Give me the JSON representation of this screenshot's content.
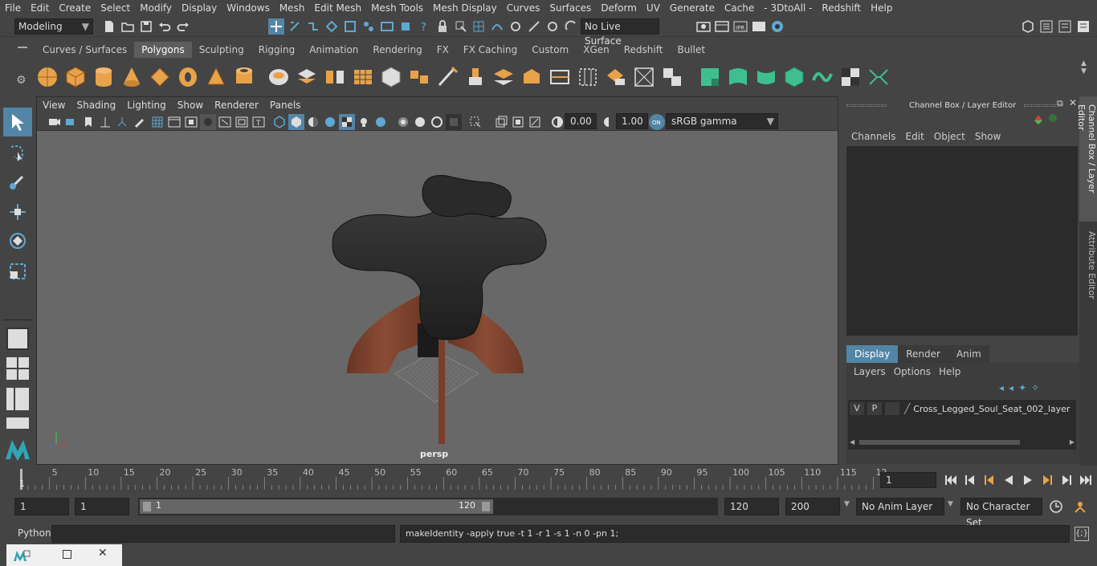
{
  "menubar": {
    "items": [
      "File",
      "Edit",
      "Create",
      "Select",
      "Modify",
      "Display",
      "Windows",
      "Mesh",
      "Edit Mesh",
      "Mesh Tools",
      "Mesh Display",
      "Curves",
      "Surfaces",
      "Deform",
      "UV",
      "Generate",
      "Cache",
      "- 3DtoAll -",
      "Redshift",
      "Help"
    ]
  },
  "statusline": {
    "mode": "Modeling",
    "live_surface": "No Live Surface"
  },
  "shelf": {
    "tabs": [
      "Curves / Surfaces",
      "Polygons",
      "Sculpting",
      "Rigging",
      "Animation",
      "Rendering",
      "FX",
      "FX Caching",
      "Custom",
      "XGen",
      "Redshift",
      "Bullet"
    ],
    "active_tab": "Polygons"
  },
  "viewport": {
    "menu": [
      "View",
      "Shading",
      "Lighting",
      "Show",
      "Renderer",
      "Panels"
    ],
    "exposure": "0.00",
    "gamma": "1.00",
    "colorspace": "sRGB gamma",
    "camera_label": "persp"
  },
  "channelbox": {
    "title": "Channel Box / Layer Editor",
    "menu": [
      "Channels",
      "Edit",
      "Object",
      "Show"
    ]
  },
  "layereditor": {
    "tabs": [
      "Display",
      "Render",
      "Anim"
    ],
    "active_tab": "Display",
    "menu": [
      "Layers",
      "Options",
      "Help"
    ],
    "layer": {
      "v": "V",
      "p": "P",
      "name": "Cross_Legged_Soul_Seat_002_layer"
    }
  },
  "sidetabs": {
    "channel": "Channel Box / Layer Editor",
    "attribute": "Attribute Editor"
  },
  "timeline": {
    "ticks": [
      "5",
      "10",
      "15",
      "20",
      "25",
      "30",
      "35",
      "40",
      "45",
      "50",
      "55",
      "60",
      "65",
      "70",
      "75",
      "80",
      "85",
      "90",
      "95",
      "100",
      "105",
      "110",
      "115",
      "12"
    ],
    "start_tick": "1",
    "current_frame": "1"
  },
  "range": {
    "start": "1",
    "playback_start": "1",
    "slider_start": "1",
    "slider_end": "120",
    "end": "120",
    "anim_end": "200",
    "anim_layer": "No Anim Layer",
    "char_set": "No Character Set"
  },
  "cmdline": {
    "label": "Python",
    "output": "makeIdentity -apply true -t 1 -r 1 -s 1 -n 0 -pn 1;"
  },
  "colors": {
    "accent": "#5285a6",
    "bg": "#444444",
    "viewport": "#686868",
    "shelf_orange": "#e8a24a",
    "shelf_green": "#3fbf8f"
  }
}
